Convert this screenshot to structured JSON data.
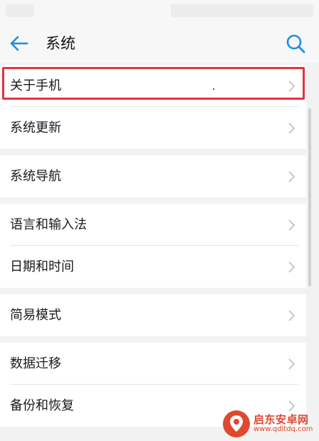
{
  "header": {
    "title": "系统",
    "back_icon": "arrow-left-icon",
    "search_icon": "search-icon"
  },
  "groups": [
    {
      "items": [
        {
          "label": "关于手机"
        },
        {
          "label": "系统更新"
        }
      ]
    },
    {
      "items": [
        {
          "label": "系统导航"
        }
      ]
    },
    {
      "items": [
        {
          "label": "语言和输入法"
        },
        {
          "label": "日期和时间"
        }
      ]
    },
    {
      "items": [
        {
          "label": "简易模式"
        }
      ]
    },
    {
      "items": [
        {
          "label": "数据迁移"
        },
        {
          "label": "备份和恢复"
        }
      ]
    }
  ],
  "highlighted_item": "关于手机",
  "watermark": {
    "name": "启东安卓网",
    "url": "www.qdltdq.com"
  },
  "colors": {
    "accent": "#1a8fe3",
    "highlight": "#e8323c",
    "background": "#f2f2f2"
  }
}
